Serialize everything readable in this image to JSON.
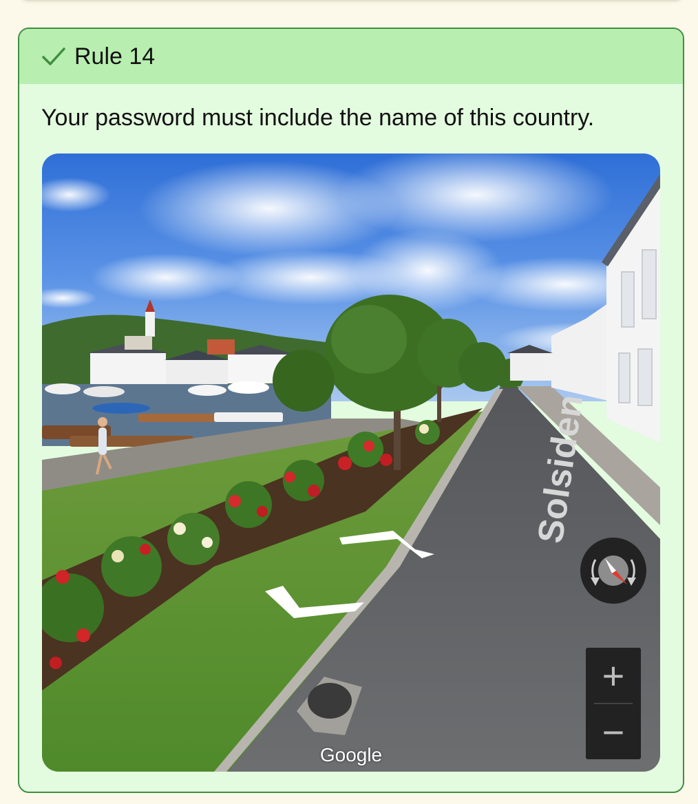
{
  "rule": {
    "title": "Rule 14",
    "status": "satisfied",
    "description": "Your password must include the name of this country."
  },
  "streetview": {
    "street_label": "Solsiden",
    "watermark": "Google",
    "zoom_in_label": "+",
    "zoom_out_label": "−",
    "icons": [
      "compass-icon",
      "zoom-in-icon",
      "zoom-out-icon",
      "navigation-arrow-icon"
    ]
  },
  "colors": {
    "header_bg": "#b8eeb0",
    "card_bg": "#e3fbdf",
    "card_border": "#3e8e41",
    "check": "#3e8e41",
    "page_bg": "#fdf9ea"
  }
}
